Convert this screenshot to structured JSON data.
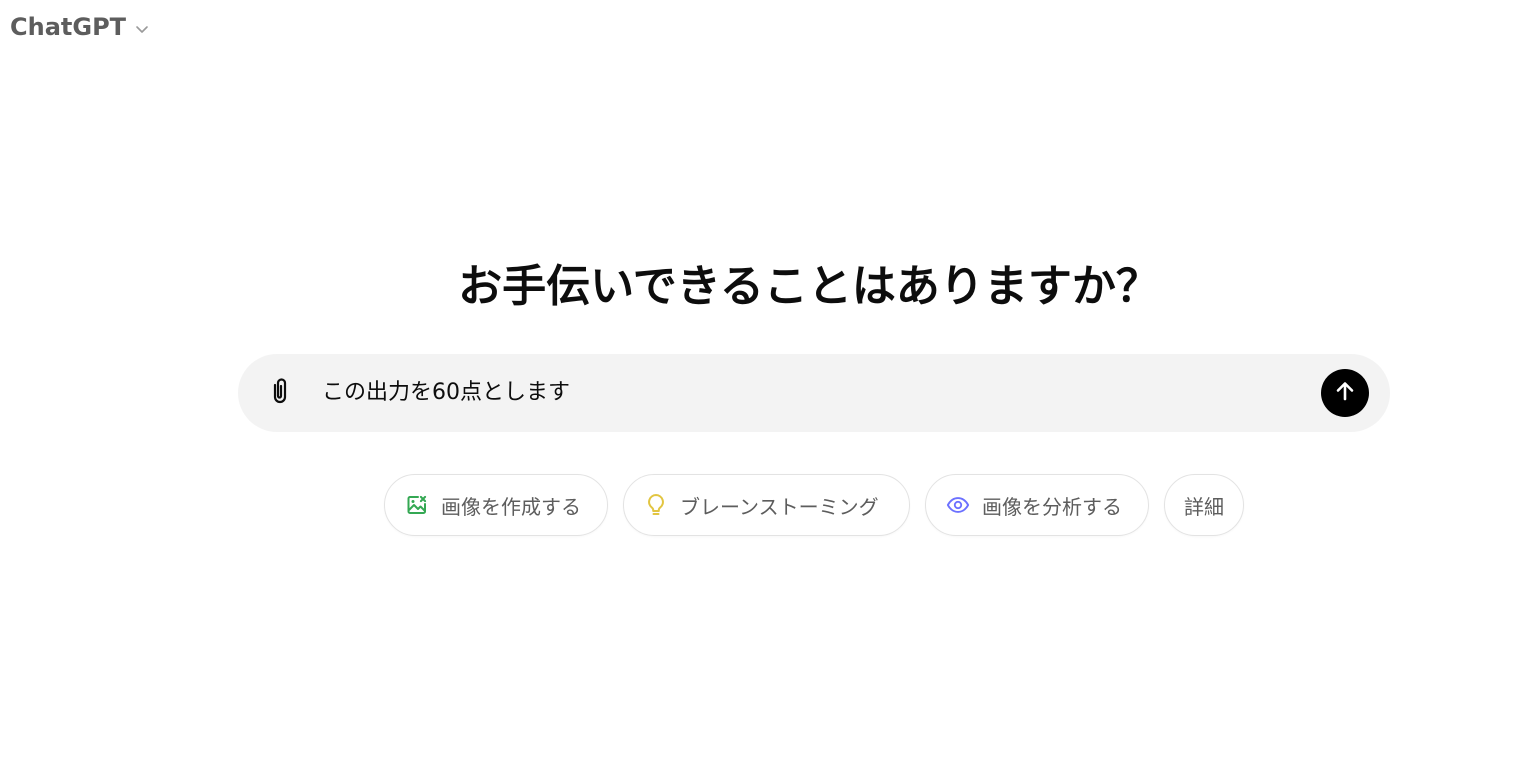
{
  "header": {
    "model_name": "ChatGPT",
    "model_chevron_icon": "chevron-down-icon"
  },
  "main": {
    "heading": "お手伝いできることはありますか？"
  },
  "composer": {
    "attach_icon": "paperclip-icon",
    "input_value": "この出力を60点とします",
    "send_icon": "arrow-up-icon"
  },
  "suggestions": [
    {
      "label": "画像を作成する",
      "icon": "image-create-icon",
      "color": "#34a853"
    },
    {
      "label": "ブレーンストーミング",
      "icon": "lightbulb-icon",
      "color": "#e2c541"
    },
    {
      "label": "画像を分析する",
      "icon": "eye-icon",
      "color": "#6c71ff"
    },
    {
      "label": "詳細"
    }
  ]
}
